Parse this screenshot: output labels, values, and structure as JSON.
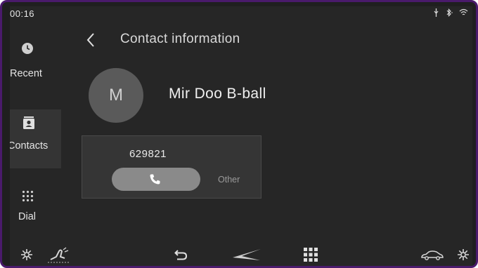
{
  "status": {
    "time": "00:16",
    "icons": [
      "usb-icon",
      "bluetooth-icon",
      "wifi-icon"
    ]
  },
  "sidebar": {
    "items": [
      {
        "label": "Recent",
        "icon": "clock-icon",
        "active": false
      },
      {
        "label": "Contacts",
        "icon": "contact-card-icon",
        "active": true
      },
      {
        "label": "Dial",
        "icon": "keypad-icon",
        "active": false
      }
    ]
  },
  "header": {
    "title": "Contact information"
  },
  "contact": {
    "initial": "M",
    "name": "Mir Doo B-ball",
    "numbers": [
      {
        "number": "629821",
        "type": "Other"
      }
    ]
  },
  "bottom_bar": {
    "icons": [
      "climate-icon",
      "seat-icon",
      "back-icon",
      "home-logo-icon",
      "apps-grid-icon",
      "car-icon",
      "fan-icon"
    ]
  },
  "colors": {
    "frame": "#4a1a6b",
    "background": "#262626",
    "active_item": "#343434",
    "call_button": "#8a8a8a"
  }
}
